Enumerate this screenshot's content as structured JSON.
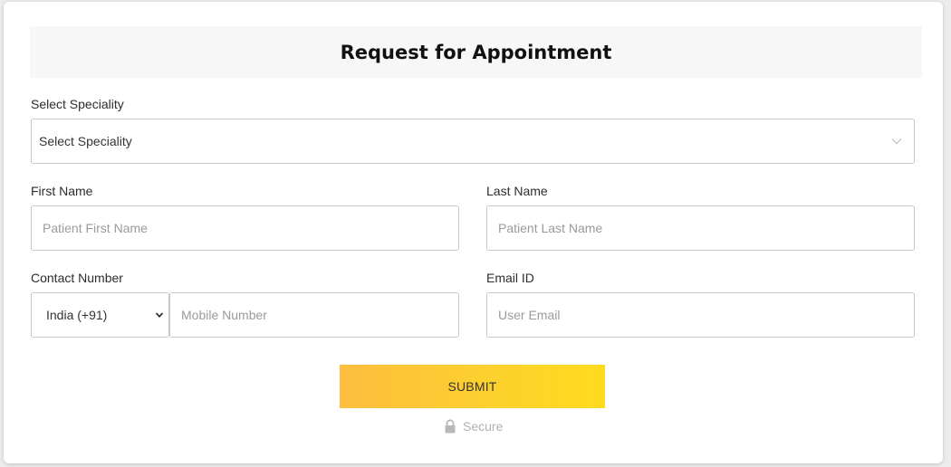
{
  "form": {
    "title": "Request for Appointment",
    "speciality": {
      "label": "Select Speciality",
      "selected": "Select Speciality"
    },
    "first_name": {
      "label": "First Name",
      "placeholder": "Patient First Name"
    },
    "last_name": {
      "label": "Last Name",
      "placeholder": "Patient Last Name"
    },
    "contact": {
      "label": "Contact Number",
      "country_selected": "India (+91)",
      "placeholder": "Mobile Number"
    },
    "email": {
      "label": "Email ID",
      "placeholder": "User Email"
    },
    "submit_label": "SUBMIT",
    "secure_label": "Secure"
  },
  "colors": {
    "submit_gradient_start": "#fdbd3e",
    "submit_gradient_end": "#fedb1e",
    "header_bg": "#f7f7f7",
    "border": "#c8c8c8"
  },
  "icons": {
    "speciality_dropdown": "chevron-down-icon",
    "country_dropdown": "caret-down-icon",
    "secure": "lock-icon"
  }
}
